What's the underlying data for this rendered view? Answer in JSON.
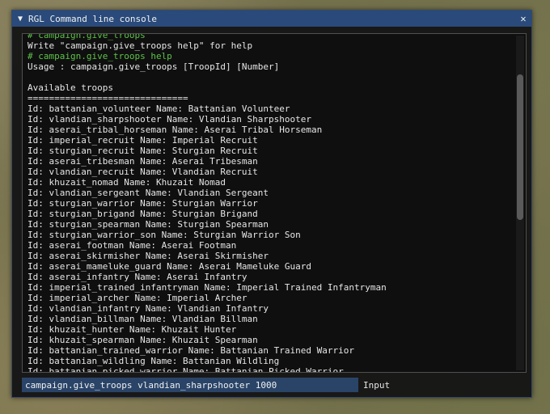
{
  "window": {
    "title": "RGL Command line console",
    "collapse_glyph": "▼",
    "close_glyph": "✕"
  },
  "log": [
    {
      "text": "# campaign.give_troops",
      "type": "cmd"
    },
    {
      "text": "Write \"campaign.give_troops help\" for help",
      "type": "out"
    },
    {
      "text": "# campaign.give_troops help",
      "type": "cmd"
    },
    {
      "text": "Usage : campaign.give_troops [TroopId] [Number]",
      "type": "out"
    },
    {
      "text": "",
      "type": "out"
    },
    {
      "text": "Available troops",
      "type": "out"
    },
    {
      "text": "==============================",
      "type": "out"
    },
    {
      "text": "Id: battanian_volunteer Name: Battanian Volunteer",
      "type": "out"
    },
    {
      "text": "Id: vlandian_sharpshooter Name: Vlandian Sharpshooter",
      "type": "out"
    },
    {
      "text": "Id: aserai_tribal_horseman Name: Aserai Tribal Horseman",
      "type": "out"
    },
    {
      "text": "Id: imperial_recruit Name: Imperial Recruit",
      "type": "out"
    },
    {
      "text": "Id: sturgian_recruit Name: Sturgian Recruit",
      "type": "out"
    },
    {
      "text": "Id: aserai_tribesman Name: Aserai Tribesman",
      "type": "out"
    },
    {
      "text": "Id: vlandian_recruit Name: Vlandian Recruit",
      "type": "out"
    },
    {
      "text": "Id: khuzait_nomad Name: Khuzait Nomad",
      "type": "out"
    },
    {
      "text": "Id: vlandian_sergeant Name: Vlandian Sergeant",
      "type": "out"
    },
    {
      "text": "Id: sturgian_warrior Name: Sturgian Warrior",
      "type": "out"
    },
    {
      "text": "Id: sturgian_brigand Name: Sturgian Brigand",
      "type": "out"
    },
    {
      "text": "Id: sturgian_spearman Name: Sturgian Spearman",
      "type": "out"
    },
    {
      "text": "Id: sturgian_warrior_son Name: Sturgian Warrior Son",
      "type": "out"
    },
    {
      "text": "Id: aserai_footman Name: Aserai Footman",
      "type": "out"
    },
    {
      "text": "Id: aserai_skirmisher Name: Aserai Skirmisher",
      "type": "out"
    },
    {
      "text": "Id: aserai_mameluke_guard Name: Aserai Mameluke Guard",
      "type": "out"
    },
    {
      "text": "Id: aserai_infantry Name: Aserai Infantry",
      "type": "out"
    },
    {
      "text": "Id: imperial_trained_infantryman Name: Imperial Trained Infantryman",
      "type": "out"
    },
    {
      "text": "Id: imperial_archer Name: Imperial Archer",
      "type": "out"
    },
    {
      "text": "Id: vlandian_infantry Name: Vlandian Infantry",
      "type": "out"
    },
    {
      "text": "Id: vlandian_billman Name: Vlandian Billman",
      "type": "out"
    },
    {
      "text": "Id: khuzait_hunter Name: Khuzait Hunter",
      "type": "out"
    },
    {
      "text": "Id: khuzait_spearman Name: Khuzait Spearman",
      "type": "out"
    },
    {
      "text": "Id: battanian_trained_warrior Name: Battanian Trained Warrior",
      "type": "out"
    },
    {
      "text": "Id: battanian_wildling Name: Battanian Wildling",
      "type": "out"
    },
    {
      "text": "Id: battanian_picked_warrior Name: Battanian Picked Warrior",
      "type": "out"
    }
  ],
  "input": {
    "value": "campaign.give_troops vlandian_sharpshooter 1000",
    "label": "Input"
  },
  "colors": {
    "title_bar": "#294a7a",
    "command_text": "#5ec24a",
    "input_bg": "#2a4468"
  }
}
